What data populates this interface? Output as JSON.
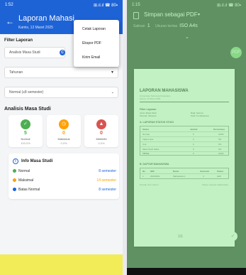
{
  "left": {
    "status": {
      "time": "1:52",
      "icons": "⊞.ıl.ıl ☎ 80▪"
    },
    "header": {
      "title": "Laporan Mahasi",
      "subtitle": "Kamis, 13 Maret 2025",
      "back_icon": "arrow-left-icon",
      "bg_color": "#1e63d6"
    },
    "filter": {
      "title": "Filter Laporan",
      "field1": "Analisis Masa Studi",
      "field1_badge": "C",
      "field2": "Tahunan",
      "field3": "Normal (≤8 semester)"
    },
    "menu": {
      "items": [
        "Cetak Laporan",
        "Ekspor PDF",
        "Kirim Email"
      ]
    },
    "analysis": {
      "title": "Analisis Masa Studi",
      "cards": [
        {
          "icon": "check-icon",
          "value": "5",
          "label": "Normal",
          "pct": "100.0%",
          "color": "#4caf50"
        },
        {
          "icon": "clock-icon",
          "value": "0",
          "label": "Maksimal",
          "pct": "0.0%",
          "color": "#ffa000"
        },
        {
          "icon": "warning-icon",
          "value": "0",
          "label": "Melebihi",
          "pct": "0.0%",
          "color": "#d9534f"
        }
      ]
    },
    "info": {
      "title": "Info Masa Studi",
      "rows": [
        {
          "label": "Normal",
          "value": "8 semester",
          "color": "#4caf50"
        },
        {
          "label": "Maksimal",
          "value": "14 semester",
          "color": "#ffa000"
        },
        {
          "label": "Batas Normal",
          "value": "8 semester",
          "color": "#1e63d6"
        }
      ]
    }
  },
  "right": {
    "status": {
      "time": "1:15",
      "icons": "⊞.ıl.ıl ☎ 80▪"
    },
    "header": {
      "title": "Simpan sebagai PDF",
      "copies_label": "Salinan",
      "copies_value": "1",
      "size_label": "Ukuran kertas",
      "size_value": "ISO A4s"
    },
    "document": {
      "title": "LAPORAN MAHASISWA",
      "sub1": "Universitas Teknologi Nusantara",
      "sub2": "Kamis, 13 Maret 2025",
      "filter_heading": "Filter Laporan",
      "filter_left": [
        "Jenis: Masa Studi",
        "Periode: Tahunan"
      ],
      "filter_right": [
        "Data: Semua",
        "Total: 5 mahasiswa"
      ],
      "section_a": "A. LAPORAN STATUS STUDI",
      "table_a_header": [
        "Status",
        "Jumlah",
        "Persentase"
      ],
      "table_a_rows": [
        [
          "Normal",
          "5",
          "100%"
        ],
        [
          "Tidak Lulus",
          "0",
          "0%"
        ],
        [
          "Cuti",
          "0",
          "0%"
        ],
        [
          "Masa Studi Habis",
          "0",
          "0%"
        ],
        [
          "TOTAL",
          "5",
          "100%"
        ]
      ],
      "section_b": "B. DAFTAR MAHASISWA",
      "table_b_header": [
        "No",
        "NIM",
        "Nama",
        "Semester",
        "Status"
      ],
      "table_b_row": [
        "1",
        "20210001",
        "Mahasiswa 1",
        "4",
        "Aktif"
      ],
      "footer_left": "Dicetak oleh: Admin",
      "footer_right": "Sistem Laporan Mahasiswa",
      "page": "1/1"
    },
    "overlay_color": "#8fe592"
  }
}
